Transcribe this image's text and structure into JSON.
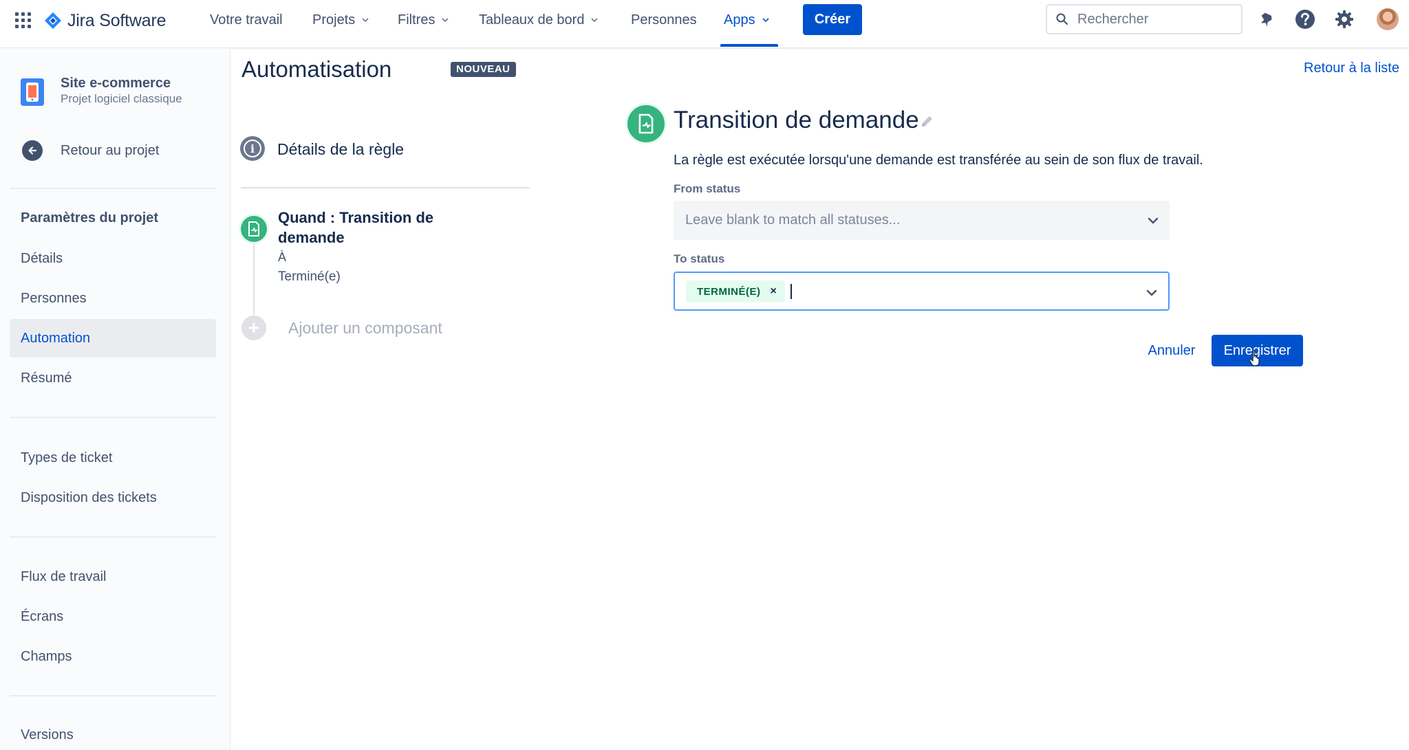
{
  "topnav": {
    "logo_text": "Jira Software",
    "items": [
      {
        "label": "Votre travail"
      },
      {
        "label": "Projets"
      },
      {
        "label": "Filtres"
      },
      {
        "label": "Tableaux de bord"
      },
      {
        "label": "Personnes"
      },
      {
        "label": "Apps"
      }
    ],
    "active_item": "Apps",
    "create_label": "Créer",
    "search_placeholder": "Rechercher",
    "accent_color": "#0052cc"
  },
  "sidebar": {
    "project_name": "Site e-commerce",
    "project_type": "Projet logiciel classique",
    "back_label": "Retour au projet",
    "section_heading": "Paramètres du projet",
    "items": [
      {
        "label": "Détails"
      },
      {
        "label": "Personnes"
      },
      {
        "label": "Automation"
      },
      {
        "label": "Résumé"
      },
      {
        "label": "Types de ticket"
      },
      {
        "label": "Disposition des tickets"
      },
      {
        "label": "Flux de travail"
      },
      {
        "label": "Écrans"
      },
      {
        "label": "Champs"
      },
      {
        "label": "Versions"
      }
    ],
    "active_item": "Automation"
  },
  "main": {
    "title": "Automatisation",
    "badge": "NOUVEAU",
    "back_to_list": "Retour à la liste",
    "rule_details_label": "Détails de la règle",
    "trigger": {
      "title": "Quand : Transition de demande",
      "sub_label": "À",
      "sub_value": "Terminé(e)"
    },
    "add_component_label": "Ajouter un composant"
  },
  "editor": {
    "title": "Transition de demande",
    "description": "La règle est exécutée lorsqu'une demande est transférée au sein de son flux de travail.",
    "from_status": {
      "label": "From status",
      "placeholder": "Leave blank to match all statuses..."
    },
    "to_status": {
      "label": "To status",
      "selected_tag": "TERMINÉ(E)",
      "remove_glyph": "×"
    },
    "cancel_label": "Annuler",
    "save_label": "Enregistrer",
    "success_color": "#36b37e"
  }
}
